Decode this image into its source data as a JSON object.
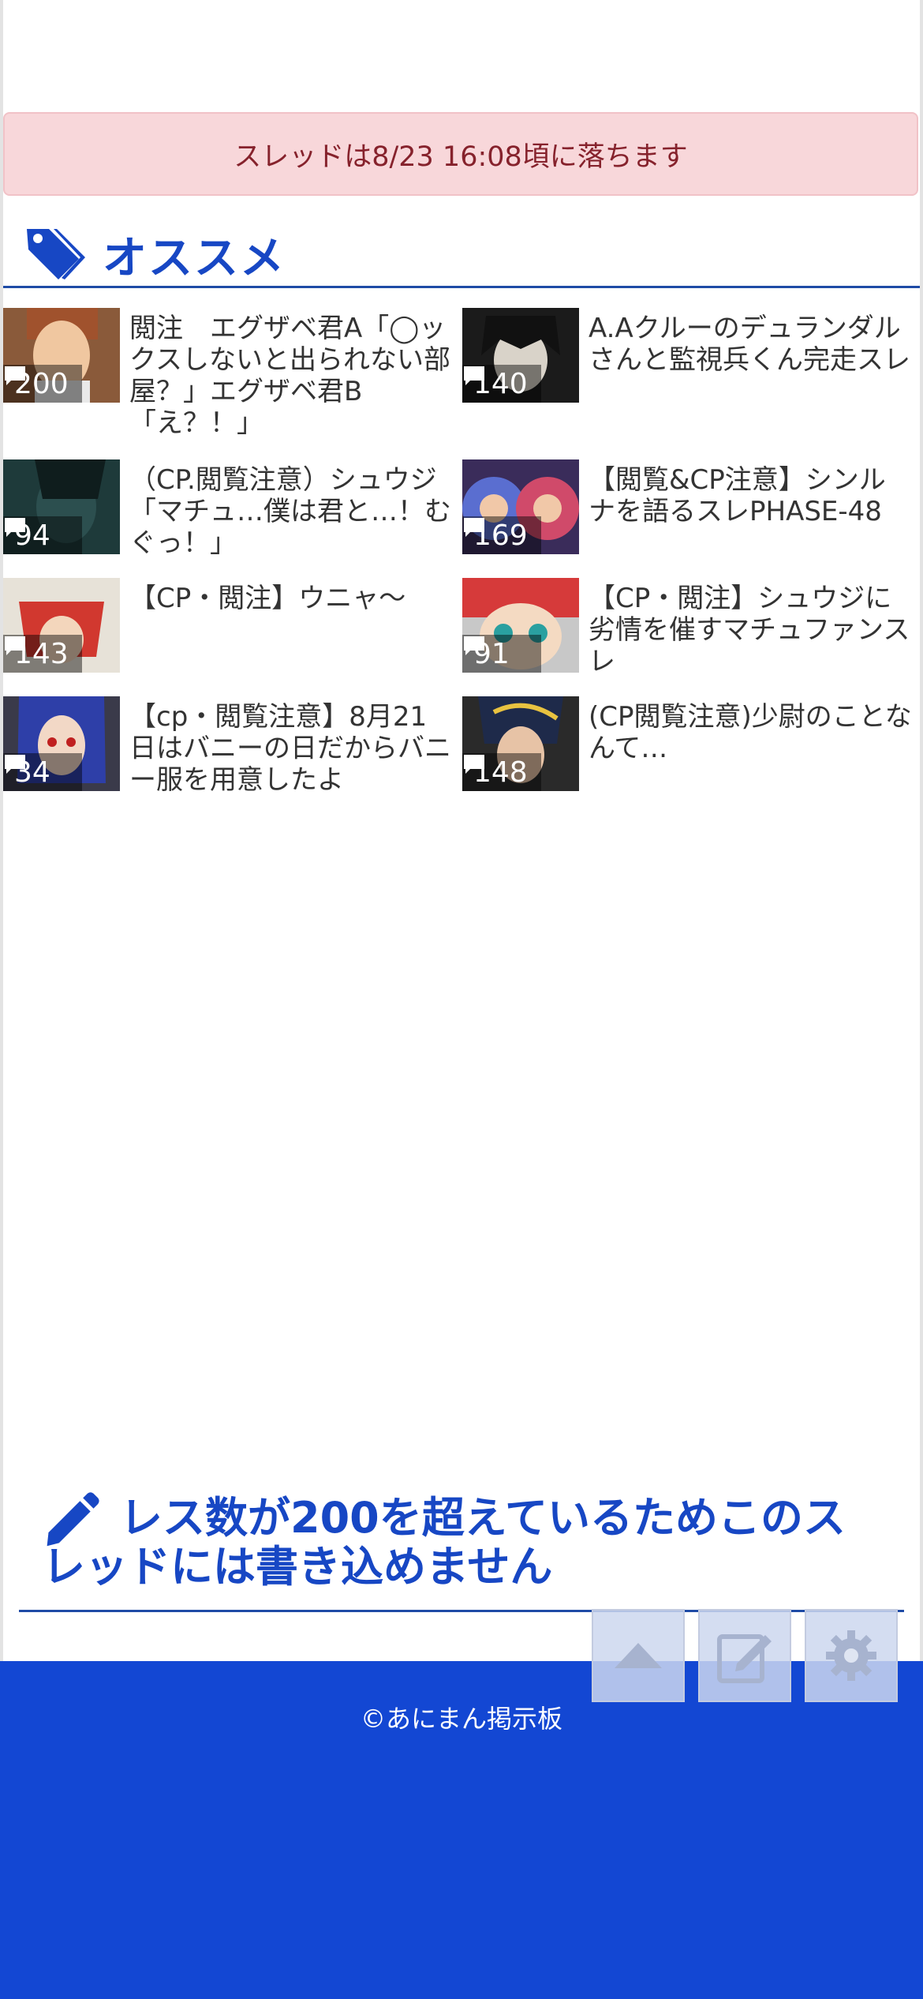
{
  "notice": {
    "text": "スレッドは8/23 16:08頃に落ちます"
  },
  "recommend": {
    "heading": "オススメ",
    "icon": "tag-icon",
    "items": [
      {
        "count": "200",
        "title": "閲注　エグザベ君A「◯ックスしないと出られない部屋？」エグザベ君B「え？！」"
      },
      {
        "count": "140",
        "title": "A.Aクルーのデュランダルさんと監視兵くん完走スレ"
      },
      {
        "count": "94",
        "title": "（CP.閲覧注意）シュウジ「マチュ…僕は君と…！むぐっ！」"
      },
      {
        "count": "169",
        "title": "【閲覧&CP注意】シンルナを語るスレPHASE-48"
      },
      {
        "count": "143",
        "title": "【CP・閲注】ウニャ〜"
      },
      {
        "count": "91",
        "title": "【CP・閲注】シュウジに劣情を催すマチュファンスレ"
      },
      {
        "count": "34",
        "title": "【cp・閲覧注意】8月21日はバニーの日だからバニー服を用意したよ"
      },
      {
        "count": "148",
        "title": "(CP閲覧注意)少尉のことなんて…"
      }
    ]
  },
  "post_form": {
    "message": "レス数が200を超えているためこのスレッドには書き込めません",
    "icon": "pencil-icon"
  },
  "footer": {
    "copyright": "©あにまん掲示板"
  },
  "floating_buttons": [
    {
      "name": "scroll-top-button",
      "icon": "triangle-up-icon"
    },
    {
      "name": "write-button",
      "icon": "edit-icon"
    },
    {
      "name": "settings-button",
      "icon": "gear-icon"
    }
  ],
  "colors": {
    "accent": "#1747c4",
    "footer": "#1347d3",
    "notice_bg": "#f8d7da",
    "notice_text": "#86222c"
  }
}
